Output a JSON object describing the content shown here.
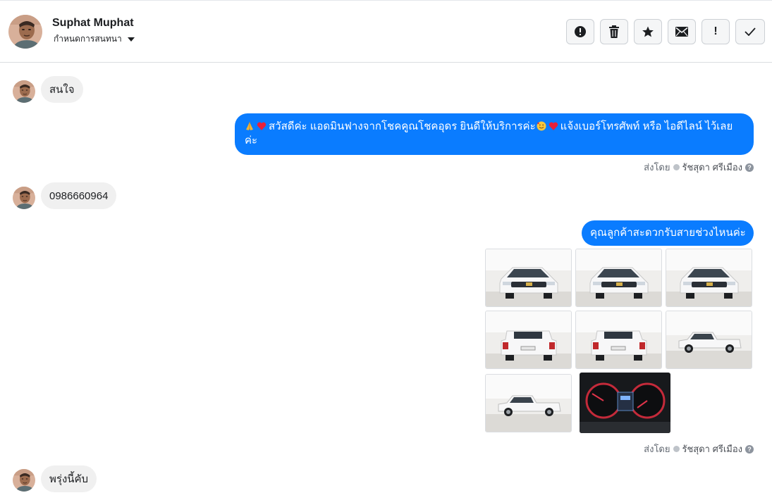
{
  "header": {
    "contact_name": "Suphat Muphat",
    "conversation_menu": "กำหนดการสนทนา"
  },
  "toolbar": {
    "buttons": [
      {
        "icon": "alert-circle-icon",
        "name": "report-spam-button"
      },
      {
        "icon": "trash-icon",
        "name": "delete-button"
      },
      {
        "icon": "star-icon",
        "name": "star-button"
      },
      {
        "icon": "mail-icon",
        "name": "mark-unread-button"
      },
      {
        "icon": "exclamation-icon",
        "name": "mark-important-button",
        "label": "!"
      },
      {
        "icon": "check-icon",
        "name": "mark-done-button"
      }
    ]
  },
  "messages": [
    {
      "direction": "incoming",
      "text": "สนใจ"
    },
    {
      "direction": "outgoing",
      "text_part1": "สวัสดีค่ะ แอดมินฟางจากโชคคูณโชคอุดร ยินดีให้บริการค่ะ",
      "text_part2": "แจ้งเบอร์โทรศัพท์ หรือ ไอดีไลน์  ไว้เลยค่ะ",
      "sent_by_label": "ส่งโดย",
      "agent_name": "รัชสุดา ศรีเมือง",
      "help_glyph": "?"
    },
    {
      "direction": "incoming",
      "text": "0986660964"
    },
    {
      "direction": "outgoing",
      "text": "คุณลูกค้าสะดวกรับสายช่วงไหนค่ะ",
      "attachments": [
        "front-left-view",
        "front-view",
        "front-right-view",
        "rear-left-view",
        "rear-right-view",
        "side-right-view",
        "side-left-view",
        "instrument-cluster"
      ],
      "sent_by_label": "ส่งโดย",
      "agent_name": "รัชสุดา ศรีเมือง",
      "help_glyph": "?"
    },
    {
      "direction": "incoming",
      "text": "พรุ่งนี้คับ"
    }
  ],
  "colors": {
    "outgoing_bubble": "#0a7cff",
    "incoming_bubble": "#f0f0f0",
    "truck_white": "#f4f5f6"
  }
}
